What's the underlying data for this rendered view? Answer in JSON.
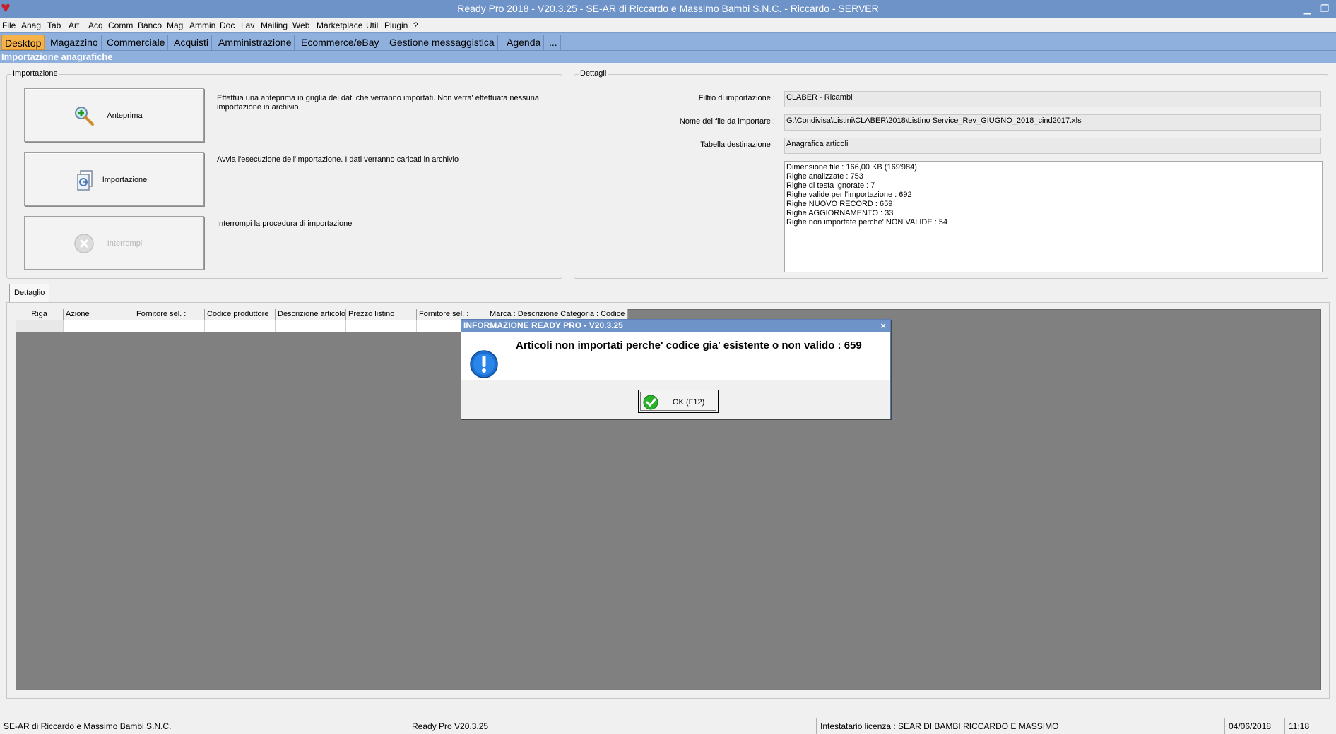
{
  "window": {
    "title": "Ready Pro 2018 - V20.3.25 - SE-AR di Riccardo e Massimo Bambi S.N.C. - Riccardo - SERVER"
  },
  "menu": [
    "File",
    "Anag",
    "Tab",
    "Art",
    "Acq",
    "Comm",
    "Banco",
    "Mag",
    "Ammin",
    "Doc",
    "Lav",
    "Mailing",
    "Web",
    "Marketplace",
    "Util",
    "Plugin",
    "?"
  ],
  "tabs": [
    "Desktop",
    "Magazzino",
    "Commerciale",
    "Acquisti",
    "Amministrazione",
    "Ecommerce/eBay",
    "Gestione messaggistica",
    "Agenda",
    "..."
  ],
  "section": {
    "title": "Importazione anagrafiche"
  },
  "import_group": {
    "legend": "Importazione",
    "buttons": [
      {
        "label": "Anteprima",
        "icon": "magnifier-plus-icon",
        "enabled": true,
        "description": "Effettua una anteprima in griglia dei dati che verranno importati. Non verra' effettuata nessuna importazione in archivio."
      },
      {
        "label": "Importazione",
        "icon": "import-document-icon",
        "enabled": true,
        "description": "Avvia l'esecuzione dell'importazione. I dati verranno caricati in archivio"
      },
      {
        "label": "Interrompi",
        "icon": "stop-icon",
        "enabled": false,
        "description": "Interrompi la procedura di importazione"
      }
    ]
  },
  "details_group": {
    "legend": "Dettagli",
    "filter_label": "Filtro di importazione :",
    "filter_value": "CLABER - Ricambi",
    "file_label": "Nome del file da importare :",
    "file_value": "G:\\Condivisa\\Listini\\CLABER\\2018\\Listino Service_Rev_GIUGNO_2018_cind2017.xls",
    "table_label": "Tabella destinazione :",
    "table_value": "Anagrafica articoli",
    "info_lines": [
      "Dimensione file : 166,00 KB (169'984)",
      "Righe analizzate : 753",
      "Righe di testa ignorate : 7",
      "Righe valide per l'importazione : 692",
      "Righe NUOVO RECORD : 659",
      "Righe AGGIORNAMENTO  : 33",
      "Righe non importate perche' NON VALIDE : 54"
    ]
  },
  "detail_tab": {
    "label": "Dettaglio"
  },
  "grid": {
    "columns": [
      "Riga",
      "Azione",
      "Fornitore sel. :",
      "Codice produttore",
      "Descrizione articolo",
      "Prezzo listino",
      "Fornitore sel. :",
      "Marca : Descrizione  Categoria : Codice"
    ]
  },
  "dialog": {
    "title": "INFORMAZIONE READY PRO - V20.3.25",
    "close": "×",
    "message": "Articoli non importati perche' codice gia' esistente o non valido : 659",
    "ok_label": "OK (F12)"
  },
  "statusbar": {
    "company": "SE-AR di Riccardo e Massimo Bambi S.N.C.",
    "version": "Ready Pro V20.3.25",
    "license": "Intestatario licenza : SEAR DI BAMBI RICCARDO E MASSIMO",
    "date": "04/06/2018",
    "time": "11:18"
  },
  "colors": {
    "accent": "#6e93c9",
    "tab_strip": "#8fb0dc",
    "active_tab": "#f6b24a",
    "grid_bg": "#808080"
  }
}
